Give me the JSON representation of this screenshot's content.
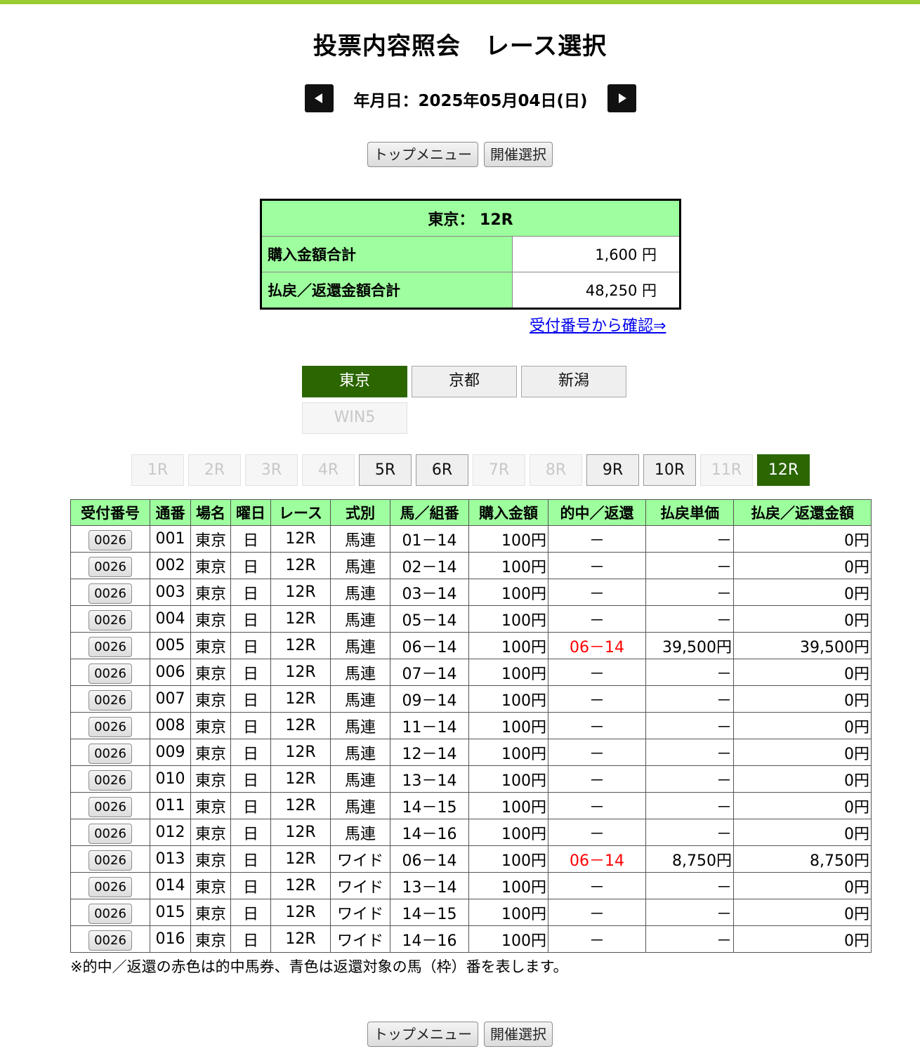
{
  "page": {
    "title": "投票内容照会　レース選択",
    "date_text": "年月日：2025年05月04日(日)"
  },
  "nav": {
    "top_menu": "トップメニュー",
    "meeting_select": "開催選択"
  },
  "summary": {
    "header": "東京：  12R",
    "purchase_label": "購入金額合計",
    "purchase_value": "1,600 円",
    "payout_label": "払戻／返還金額合計",
    "payout_value": "48,250 円",
    "confirm_link": "受付番号から確認⇒"
  },
  "venues": [
    {
      "label": "東京",
      "state": "active"
    },
    {
      "label": "京都",
      "state": "enabled"
    },
    {
      "label": "新潟",
      "state": "enabled"
    },
    {
      "label": "WIN5",
      "state": "disabled"
    }
  ],
  "races": [
    {
      "label": "1R",
      "state": "disabled"
    },
    {
      "label": "2R",
      "state": "disabled"
    },
    {
      "label": "3R",
      "state": "disabled"
    },
    {
      "label": "4R",
      "state": "disabled"
    },
    {
      "label": "5R",
      "state": "enabled"
    },
    {
      "label": "6R",
      "state": "enabled"
    },
    {
      "label": "7R",
      "state": "disabled"
    },
    {
      "label": "8R",
      "state": "disabled"
    },
    {
      "label": "9R",
      "state": "enabled"
    },
    {
      "label": "10R",
      "state": "enabled"
    },
    {
      "label": "11R",
      "state": "disabled"
    },
    {
      "label": "12R",
      "state": "active"
    }
  ],
  "table": {
    "columns": [
      "受付番号",
      "通番",
      "場名",
      "曜日",
      "レース",
      "式別",
      "馬／組番",
      "購入金額",
      "的中／返還",
      "払戻単価",
      "払戻／返還金額"
    ],
    "rows": [
      {
        "receipt": "0026",
        "serial": "001",
        "venue": "東京",
        "day": "日",
        "race": "12R",
        "type": "馬連",
        "combo": "01－14",
        "amount": "100円",
        "hit": "－",
        "unit": "－",
        "payout": "0円"
      },
      {
        "receipt": "0026",
        "serial": "002",
        "venue": "東京",
        "day": "日",
        "race": "12R",
        "type": "馬連",
        "combo": "02－14",
        "amount": "100円",
        "hit": "－",
        "unit": "－",
        "payout": "0円"
      },
      {
        "receipt": "0026",
        "serial": "003",
        "venue": "東京",
        "day": "日",
        "race": "12R",
        "type": "馬連",
        "combo": "03－14",
        "amount": "100円",
        "hit": "－",
        "unit": "－",
        "payout": "0円"
      },
      {
        "receipt": "0026",
        "serial": "004",
        "venue": "東京",
        "day": "日",
        "race": "12R",
        "type": "馬連",
        "combo": "05－14",
        "amount": "100円",
        "hit": "－",
        "unit": "－",
        "payout": "0円"
      },
      {
        "receipt": "0026",
        "serial": "005",
        "venue": "東京",
        "day": "日",
        "race": "12R",
        "type": "馬連",
        "combo": "06－14",
        "amount": "100円",
        "hit": "06－14",
        "unit": "39,500円",
        "payout": "39,500円",
        "is_hit": true
      },
      {
        "receipt": "0026",
        "serial": "006",
        "venue": "東京",
        "day": "日",
        "race": "12R",
        "type": "馬連",
        "combo": "07－14",
        "amount": "100円",
        "hit": "－",
        "unit": "－",
        "payout": "0円"
      },
      {
        "receipt": "0026",
        "serial": "007",
        "venue": "東京",
        "day": "日",
        "race": "12R",
        "type": "馬連",
        "combo": "09－14",
        "amount": "100円",
        "hit": "－",
        "unit": "－",
        "payout": "0円"
      },
      {
        "receipt": "0026",
        "serial": "008",
        "venue": "東京",
        "day": "日",
        "race": "12R",
        "type": "馬連",
        "combo": "11－14",
        "amount": "100円",
        "hit": "－",
        "unit": "－",
        "payout": "0円"
      },
      {
        "receipt": "0026",
        "serial": "009",
        "venue": "東京",
        "day": "日",
        "race": "12R",
        "type": "馬連",
        "combo": "12－14",
        "amount": "100円",
        "hit": "－",
        "unit": "－",
        "payout": "0円"
      },
      {
        "receipt": "0026",
        "serial": "010",
        "venue": "東京",
        "day": "日",
        "race": "12R",
        "type": "馬連",
        "combo": "13－14",
        "amount": "100円",
        "hit": "－",
        "unit": "－",
        "payout": "0円"
      },
      {
        "receipt": "0026",
        "serial": "011",
        "venue": "東京",
        "day": "日",
        "race": "12R",
        "type": "馬連",
        "combo": "14－15",
        "amount": "100円",
        "hit": "－",
        "unit": "－",
        "payout": "0円"
      },
      {
        "receipt": "0026",
        "serial": "012",
        "venue": "東京",
        "day": "日",
        "race": "12R",
        "type": "馬連",
        "combo": "14－16",
        "amount": "100円",
        "hit": "－",
        "unit": "－",
        "payout": "0円"
      },
      {
        "receipt": "0026",
        "serial": "013",
        "venue": "東京",
        "day": "日",
        "race": "12R",
        "type": "ワイド",
        "combo": "06－14",
        "amount": "100円",
        "hit": "06－14",
        "unit": "8,750円",
        "payout": "8,750円",
        "is_hit": true
      },
      {
        "receipt": "0026",
        "serial": "014",
        "venue": "東京",
        "day": "日",
        "race": "12R",
        "type": "ワイド",
        "combo": "13－14",
        "amount": "100円",
        "hit": "－",
        "unit": "－",
        "payout": "0円"
      },
      {
        "receipt": "0026",
        "serial": "015",
        "venue": "東京",
        "day": "日",
        "race": "12R",
        "type": "ワイド",
        "combo": "14－15",
        "amount": "100円",
        "hit": "－",
        "unit": "－",
        "payout": "0円"
      },
      {
        "receipt": "0026",
        "serial": "016",
        "venue": "東京",
        "day": "日",
        "race": "12R",
        "type": "ワイド",
        "combo": "14－16",
        "amount": "100円",
        "hit": "－",
        "unit": "－",
        "payout": "0円"
      }
    ]
  },
  "note": "※的中／返還の赤色は的中馬券、青色は返還対象の馬（枠）番を表します。",
  "colors": {
    "accent_bar": "#9acd32",
    "header_green": "#9eff9e",
    "active_button": "#2b6600",
    "hit_text": "#ff0000"
  },
  "icons": {
    "prev": "triangle-left-icon",
    "next": "triangle-right-icon"
  }
}
